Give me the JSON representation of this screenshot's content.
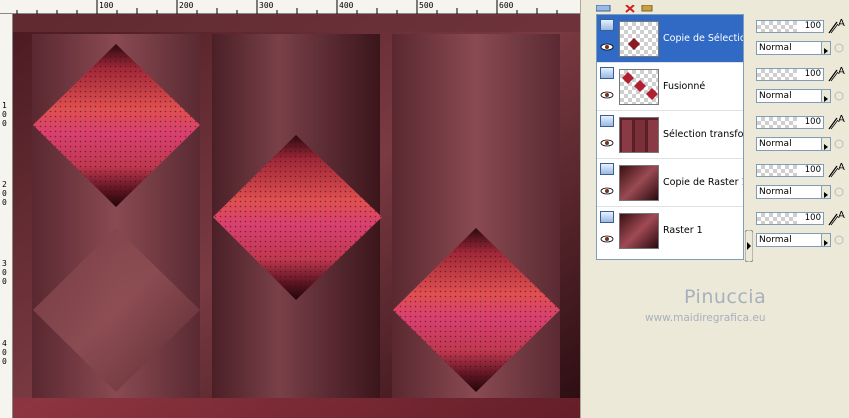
{
  "rulers": {
    "top_labels": [
      "100",
      "200",
      "300",
      "400",
      "500",
      "600"
    ],
    "left_labels": [
      "1",
      "0",
      "0",
      "2",
      "0",
      "0",
      "3",
      "0",
      "0",
      "4",
      "0",
      "0"
    ]
  },
  "layers": [
    {
      "name": "Copie de Sélection",
      "selected": true,
      "opacity": "100",
      "blend": "Normal"
    },
    {
      "name": "Fusionné",
      "selected": false,
      "opacity": "100",
      "blend": "Normal"
    },
    {
      "name": "Sélection transformée",
      "selected": false,
      "opacity": "100",
      "blend": "Normal"
    },
    {
      "name": "Copie de Raster 1",
      "selected": false,
      "opacity": "100",
      "blend": "Normal"
    },
    {
      "name": "Raster 1",
      "selected": false,
      "opacity": "100",
      "blend": "Normal"
    }
  ],
  "props": {
    "a_label": "A"
  },
  "watermark": {
    "line1": "Pinuccia",
    "line2": "www.maidiregrafica.eu"
  },
  "icons": [
    "layer-type-icon",
    "eye-icon",
    "pencil-icon",
    "lock-icon",
    "delete-icon",
    "scroll-right-arrow-icon"
  ],
  "colors": {
    "selection": "#316ac5",
    "panel": "#ece9d8",
    "diamond_core": "#e0406a",
    "background": "#5a2a30"
  }
}
